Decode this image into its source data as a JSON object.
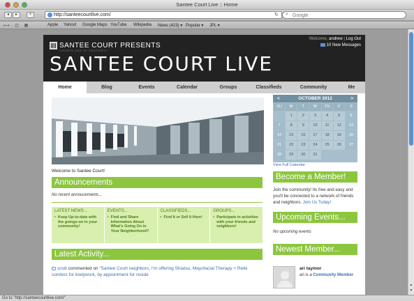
{
  "window": {
    "title": "Santee Court Live :: Home"
  },
  "browser": {
    "url": "http://santeecourtlive.com/",
    "search_placeholder": "Google",
    "bookmarks": [
      "Apple",
      "Yahoo!",
      "Google Maps",
      "YouTube",
      "Wikipedia",
      "News (423) ▾",
      "Popular ▾",
      "JPL ▾"
    ],
    "status": "Go to \"http://santeecourtlive.com/\""
  },
  "header": {
    "welcome_prefix": "Welcome,",
    "username": "andrew",
    "logout": "Log Out",
    "messages": "10 New Messages",
    "logo_prefix": "SANTEE COURT PRESENTS",
    "logo_sub": "COURTS ARE AT PROPERTY",
    "logo_main": "SANTEE COURT LIVE"
  },
  "nav": {
    "items": [
      "Home",
      "Blog",
      "Events",
      "Calendar",
      "Groups",
      "Classifieds",
      "Community",
      "Me"
    ]
  },
  "main": {
    "welcome": "Welcome to Santee Court!",
    "announcements_title": "Announcements",
    "no_announcements": "No recent annoucements...",
    "columns": [
      {
        "heading": "LATEST NEWS...",
        "text": "Keep Up-to-date with the goings-on in your community!"
      },
      {
        "heading": "EVENTS...",
        "text": "Find and Share Information About What's Going On in Your Neighborhood?"
      },
      {
        "heading": "CLASSIFIEDS...",
        "text": "Find It or Sell It Here!"
      },
      {
        "heading": "GROUPS...",
        "text": "Participate in activities with your friends and neighbors!"
      }
    ],
    "activity_title": "Latest Activity...",
    "activity_user": "scott",
    "activity_verb": "commented on",
    "activity_link": "\"Santee Court neighbors, I'm offering Shiatsu, Mayofacial Therapy + Reiki combos for bodywork, by appointment for reside"
  },
  "calendar": {
    "month": "OCTOBER 2012",
    "prev": "<",
    "next": ">",
    "days": [
      "SU",
      "M",
      "T",
      "W",
      "TH",
      "F",
      "S"
    ],
    "dates": [
      "",
      "1",
      "2",
      "3",
      "4",
      "5",
      "6",
      "7",
      "8",
      "9",
      "10",
      "11",
      "12",
      "13",
      "14",
      "15",
      "16",
      "17",
      "18",
      "19",
      "20",
      "21",
      "22",
      "23",
      "24",
      "25",
      "26",
      "27",
      "28",
      "29",
      "30",
      "31",
      "",
      "",
      ""
    ],
    "view_full": "View Full Calendar"
  },
  "sidebar": {
    "member_title": "Become a Member!",
    "member_text": "Join the community! Its free and easy and you'll be connected to a network of friends and neighbors.",
    "member_link": "Join Us Today!",
    "events_title": "Upcoming Events...",
    "no_events": "No upcoming events",
    "newest_title": "Newest Member...",
    "newest_name": "ari taymor",
    "newest_prefix": "ari is a",
    "newest_role": "Community Member"
  },
  "colors": {
    "accent_green": "#8cc63f",
    "header_dark": "#222222",
    "calendar_blue": "#6f8ea0"
  }
}
